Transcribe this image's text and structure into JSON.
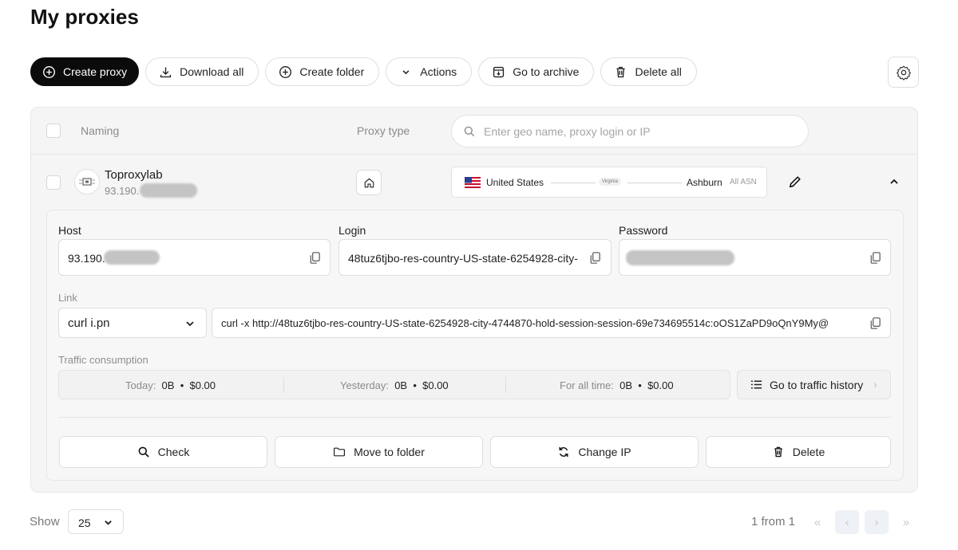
{
  "page": {
    "title": "My proxies"
  },
  "toolbar": {
    "create_proxy": "Create proxy",
    "download_all": "Download all",
    "create_folder": "Create folder",
    "actions": "Actions",
    "go_to_archive": "Go to archive",
    "delete_all": "Delete all"
  },
  "table": {
    "headers": {
      "naming": "Naming",
      "proxy_type": "Proxy type"
    },
    "search": {
      "placeholder": "Enter geo name, proxy login or IP",
      "value": ""
    }
  },
  "proxy": {
    "name": "Toproxylab",
    "ip_visible": "93.190.",
    "geo": {
      "country": "United States",
      "state": "Virginia",
      "city": "Ashburn",
      "asn": "All ASN"
    },
    "details": {
      "host_label": "Host",
      "host_value": "93.190.",
      "login_label": "Login",
      "login_value": "48tuz6tjbo-res-country-US-state-6254928-city-",
      "password_label": "Password",
      "link_label": "Link",
      "link_format": "curl i.pn",
      "link_value": "curl -x http://48tuz6tjbo-res-country-US-state-6254928-city-4744870-hold-session-session-69e734695514c:oOS1ZaPD9oQnY9My@",
      "traffic_label": "Traffic consumption",
      "traffic": {
        "today_label": "Today:",
        "today_value": "0B",
        "today_cost": "$0.00",
        "yesterday_label": "Yesterday:",
        "yesterday_value": "0B",
        "yesterday_cost": "$0.00",
        "all_time_label": "For all time:",
        "all_time_value": "0B",
        "all_time_cost": "$0.00",
        "dot": "•"
      },
      "traffic_history": "Go to traffic history"
    },
    "actions": {
      "check": "Check",
      "move_to_folder": "Move to folder",
      "change_ip": "Change IP",
      "delete": "Delete"
    }
  },
  "pagination": {
    "show_label": "Show",
    "page_size": "25",
    "page_info": "1 from 1",
    "first": "«",
    "prev": "‹",
    "next": "›",
    "last": "»"
  },
  "colors": {
    "primary_button": "#0b0b0b",
    "table_bg": "#f5f5f5",
    "border": "#e6e6e6"
  },
  "icons": {
    "create_proxy": "plus-circle-icon",
    "download_all": "download-icon",
    "create_folder": "plus-circle-icon",
    "actions": "chevron-down-icon",
    "archive": "archive-icon",
    "delete_all": "trash-icon",
    "settings": "gear-icon",
    "search": "search-icon",
    "proxy_type": "home-icon",
    "edit": "pencil-icon",
    "collapse": "chevron-up-icon",
    "copy": "copy-icon",
    "traffic_history": "list-icon",
    "check": "search-icon",
    "move": "folder-icon",
    "change_ip": "refresh-icon",
    "delete": "trash-icon"
  }
}
